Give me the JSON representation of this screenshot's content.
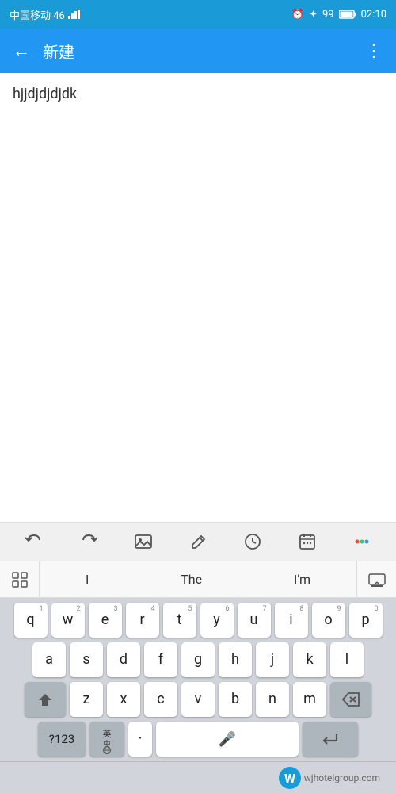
{
  "statusBar": {
    "carrier": "中国移动 46",
    "alarm": "⏰",
    "bluetooth": "✦",
    "battery": "99",
    "time": "02:10"
  },
  "titleBar": {
    "back": "←",
    "title": "新建",
    "more": "⋮"
  },
  "content": {
    "text": "hjjdjdjdjdk"
  },
  "toolbar": {
    "icons": [
      "undo",
      "redo",
      "image",
      "edit",
      "clock",
      "calendar",
      "dots"
    ]
  },
  "suggestions": {
    "left_icon": "grid",
    "words": [
      "I",
      "The",
      "I'm"
    ],
    "right_icon": "keyboard-hide"
  },
  "keyboard": {
    "row1": {
      "keys": [
        {
          "main": "q",
          "num": "1"
        },
        {
          "main": "w",
          "num": "2"
        },
        {
          "main": "e",
          "num": "3"
        },
        {
          "main": "r",
          "num": "4"
        },
        {
          "main": "t",
          "num": "5"
        },
        {
          "main": "y",
          "num": "6"
        },
        {
          "main": "u",
          "num": "7"
        },
        {
          "main": "i",
          "num": "8"
        },
        {
          "main": "o",
          "num": "9"
        },
        {
          "main": "p",
          "num": "0"
        }
      ]
    },
    "row2": {
      "keys": [
        {
          "main": "a"
        },
        {
          "main": "s"
        },
        {
          "main": "d"
        },
        {
          "main": "f"
        },
        {
          "main": "g"
        },
        {
          "main": "h"
        },
        {
          "main": "j"
        },
        {
          "main": "k"
        },
        {
          "main": "l"
        }
      ]
    },
    "row3": {
      "shift": "⇧",
      "keys": [
        {
          "main": "z"
        },
        {
          "main": "x"
        },
        {
          "main": "c"
        },
        {
          "main": "v"
        },
        {
          "main": "b"
        },
        {
          "main": "n"
        },
        {
          "main": "m"
        }
      ],
      "backspace": "⌫"
    },
    "row4": {
      "num_toggle": "?123",
      "lang": "英\n中",
      "dot": "·",
      "space_label": "",
      "mic": "🎤",
      "enter": "↵"
    }
  },
  "bottomBar": {
    "site": "wjhotelgroup.com",
    "logo_text": "W"
  }
}
